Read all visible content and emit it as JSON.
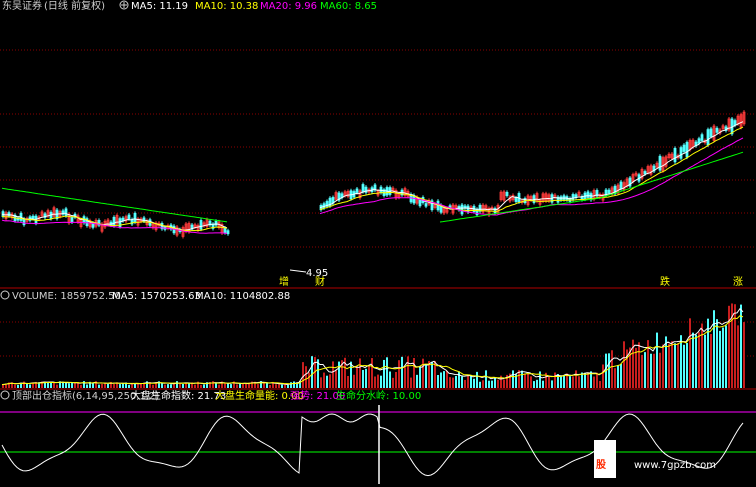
{
  "header": {
    "broker": "东吴证券",
    "period": "(日线 前复权)",
    "ma5": "MA5: 11.19",
    "ma10": "MA10: 10.38",
    "ma20": "MA20: 9.96",
    "ma60": "MA60: 8.65"
  },
  "price_panel": {
    "low_label": "4.95",
    "markers": [
      "增",
      "财",
      "跌",
      "涨"
    ]
  },
  "volume_panel": {
    "volume": "VOLUME: 1859752.50",
    "ma5": "MA5: 1570253.63",
    "ma10": "MA10: 1104802.88"
  },
  "indicator_panel": {
    "name": "顶部出仓指标(6,14,95,250,1,2)",
    "dapan": "大盘生命指数: 21.73",
    "liangneng": "大盘生命量能: 0.00",
    "qiangshi": "强势: 21.00",
    "shuiling": "生命分水岭: 10.00"
  },
  "watermark": {
    "text": "www.7gpzb.com",
    "mark": "股"
  },
  "colors": {
    "up": "#ff3b3b",
    "down": "#54ffff",
    "ma5": "#ffffff",
    "ma10": "#ffff00",
    "ma20": "#ff00ff",
    "ma60": "#00ff00",
    "grid": "#8b0000",
    "indicator_line": "#ffffff",
    "level_high": "#ff00ff",
    "level_low": "#00ff00"
  }
}
